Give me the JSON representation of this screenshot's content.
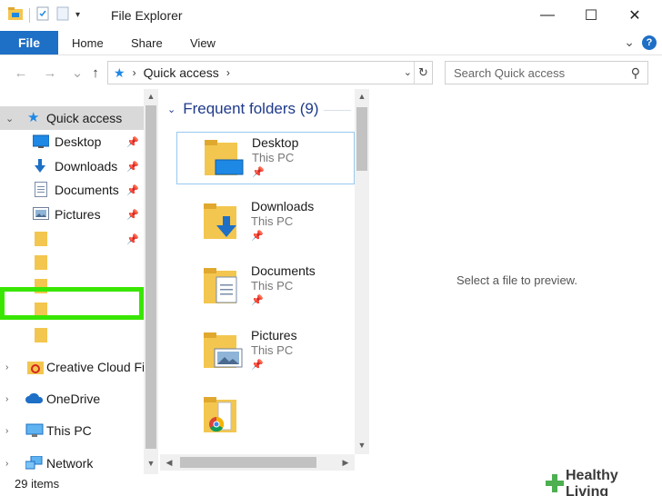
{
  "window": {
    "title": "File Explorer",
    "minimize_glyph": "—",
    "maximize_glyph": "☐",
    "close_glyph": "✕"
  },
  "ribbon": {
    "tabs": [
      "File",
      "Home",
      "Share",
      "View"
    ],
    "help_glyph": "?",
    "expand_glyph": "⌄"
  },
  "address": {
    "back_glyph": "←",
    "forward_glyph": "→",
    "up_glyph": "↑",
    "location": "Quick access",
    "dropdown_glyph": "⌄",
    "refresh_glyph": "↻",
    "search_placeholder": "Search Quick access"
  },
  "nav_pane": {
    "quick_access": "Quick access",
    "items": [
      {
        "label": "Desktop",
        "icon": "desktop-icon",
        "pinned": true
      },
      {
        "label": "Downloads",
        "icon": "downloads-icon",
        "pinned": true
      },
      {
        "label": "Documents",
        "icon": "documents-icon",
        "pinned": true
      },
      {
        "label": "Pictures",
        "icon": "pictures-icon",
        "pinned": true
      }
    ],
    "roots": [
      {
        "label": "Creative Cloud Fil",
        "icon": "creative-cloud-icon"
      },
      {
        "label": "OneDrive",
        "icon": "onedrive-icon"
      },
      {
        "label": "This PC",
        "icon": "this-pc-icon"
      },
      {
        "label": "Network",
        "icon": "network-icon"
      }
    ]
  },
  "content": {
    "group_title": "Frequent folders (9)",
    "folders": [
      {
        "name": "Desktop",
        "location": "This PC"
      },
      {
        "name": "Downloads",
        "location": "This PC"
      },
      {
        "name": "Documents",
        "location": "This PC"
      },
      {
        "name": "Pictures",
        "location": "This PC"
      }
    ]
  },
  "preview": {
    "message": "Select a file to preview."
  },
  "status": {
    "item_count": "29 items"
  },
  "watermark": {
    "brand": "Healthy Living"
  },
  "colors": {
    "accent": "#1e6fc6",
    "highlight": "#39e600",
    "folder": "#f3c64f"
  }
}
